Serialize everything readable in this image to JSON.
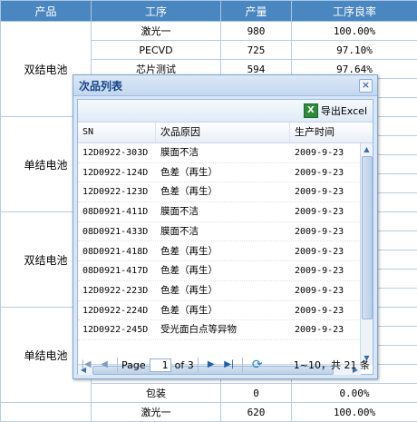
{
  "table": {
    "headers": [
      "产品",
      "工序",
      "产量",
      "工序良率"
    ],
    "groups": [
      {
        "product": "双结电池",
        "rows": [
          {
            "process": "激光一",
            "output": "980",
            "yield": "100.00%"
          },
          {
            "process": "PECVD",
            "output": "725",
            "yield": "97.10%"
          },
          {
            "process": "芯片测试",
            "output": "594",
            "yield": "97.64%"
          },
          {
            "process": "",
            "output": "",
            "yield": ""
          },
          {
            "process": "",
            "output": "",
            "yield": ""
          }
        ]
      },
      {
        "product": "单结电池",
        "rows": [
          {
            "process": "",
            "output": "",
            "yield": ""
          },
          {
            "process": "",
            "output": "",
            "yield": ""
          },
          {
            "process": "",
            "output": "",
            "yield": ""
          },
          {
            "process": "",
            "output": "",
            "yield": ""
          },
          {
            "process": "",
            "output": "",
            "yield": ""
          }
        ]
      },
      {
        "product": "双结电池",
        "rows": [
          {
            "process": "",
            "output": "",
            "yield": ""
          },
          {
            "process": "",
            "output": "",
            "yield": ""
          },
          {
            "process": "",
            "output": "",
            "yield": ""
          },
          {
            "process": "",
            "output": "",
            "yield": ""
          },
          {
            "process": "",
            "output": "",
            "yield": ""
          }
        ]
      },
      {
        "product": "单结电池",
        "rows": [
          {
            "process": "",
            "output": "",
            "yield": ""
          },
          {
            "process": "",
            "output": "",
            "yield": ""
          },
          {
            "process": "",
            "output": "",
            "yield": ""
          },
          {
            "process": "",
            "output": "",
            "yield": ""
          },
          {
            "process": "包装",
            "output": "0",
            "yield": "0.00%"
          }
        ]
      }
    ],
    "trailing_row": {
      "process": "激光一",
      "output": "620",
      "yield": "100.00%"
    }
  },
  "dialog": {
    "title": "次品列表",
    "close_glyph": "×",
    "export_label": "导出Excel",
    "excel_icon_letter": "X",
    "columns": [
      "SN",
      "次品原因",
      "生产时间"
    ],
    "rows": [
      {
        "sn": "12D0922-303D",
        "reason": "膜面不洁",
        "date": "2009-9-23"
      },
      {
        "sn": "12D0922-124D",
        "reason": "色差（再生）",
        "date": "2009-9-23"
      },
      {
        "sn": "12D0922-123D",
        "reason": "色差（再生）",
        "date": "2009-9-23"
      },
      {
        "sn": "08D0921-411D",
        "reason": "膜面不洁",
        "date": "2009-9-23"
      },
      {
        "sn": "08D0921-433D",
        "reason": "膜面不洁",
        "date": "2009-9-23"
      },
      {
        "sn": "08D0921-418D",
        "reason": "色差（再生）",
        "date": "2009-9-23"
      },
      {
        "sn": "08D0921-417D",
        "reason": "色差（再生）",
        "date": "2009-9-23"
      },
      {
        "sn": "12D0922-223D",
        "reason": "色差（再生）",
        "date": "2009-9-23"
      },
      {
        "sn": "12D0922-224D",
        "reason": "色差（再生）",
        "date": "2009-9-23"
      },
      {
        "sn": "12D0922-245D",
        "reason": "受光面白点等异物",
        "date": "2009-9-23"
      }
    ],
    "pager": {
      "page_label": "Page",
      "current_page": "1",
      "of_label": "of 3",
      "info": "1~10，共 21 条"
    }
  }
}
